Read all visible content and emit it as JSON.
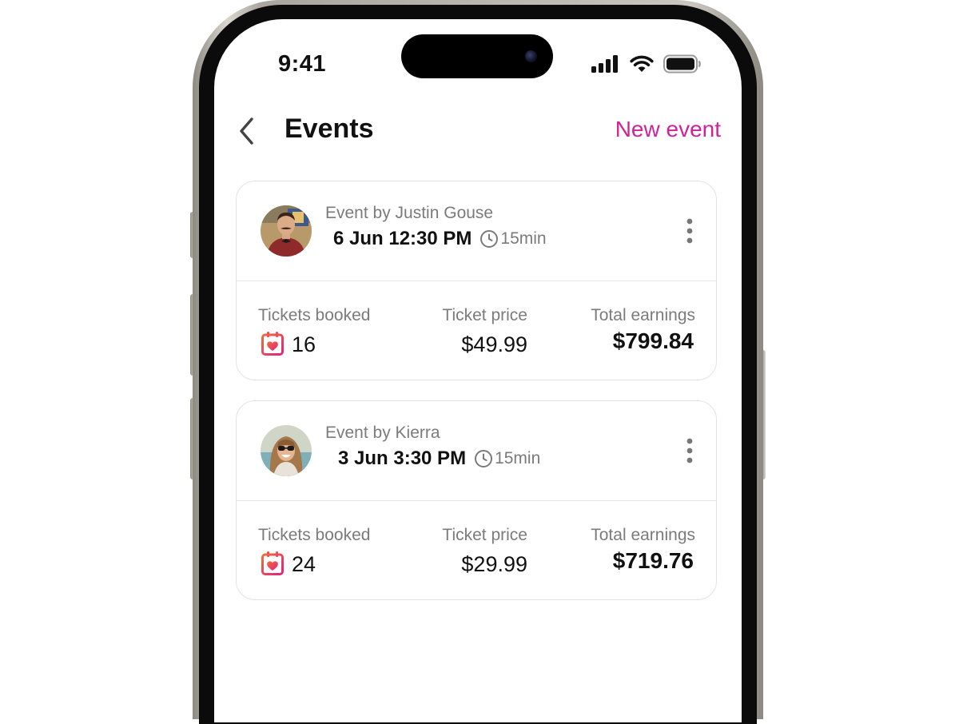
{
  "status_bar": {
    "time": "9:41"
  },
  "header": {
    "title": "Events",
    "action_label": "New event"
  },
  "events": [
    {
      "organizer": "Event by Justin Gouse",
      "datetime": "6 Jun 12:30 PM",
      "duration": "15min",
      "stats": {
        "tickets_label": "Tickets booked",
        "tickets_value": "16",
        "price_label": "Ticket price",
        "price_value": "$49.99",
        "earnings_label": "Total earnings",
        "earnings_value": "$799.84"
      }
    },
    {
      "organizer": "Event by Kierra",
      "datetime": "3 Jun 3:30 PM",
      "duration": "15min",
      "stats": {
        "tickets_label": "Tickets booked",
        "tickets_value": "24",
        "price_label": "Ticket price",
        "price_value": "$29.99",
        "earnings_label": "Total earnings",
        "earnings_value": "$719.76"
      }
    }
  ],
  "colors": {
    "accent": "#d0239a",
    "text_primary": "#111111",
    "text_secondary": "#7b7b7b",
    "card_border": "#e3e3e6"
  },
  "icons": [
    "back-chevron-icon",
    "signal-icon",
    "wifi-icon",
    "battery-icon",
    "clock-icon",
    "more-vertical-icon",
    "calendar-heart-icon"
  ]
}
